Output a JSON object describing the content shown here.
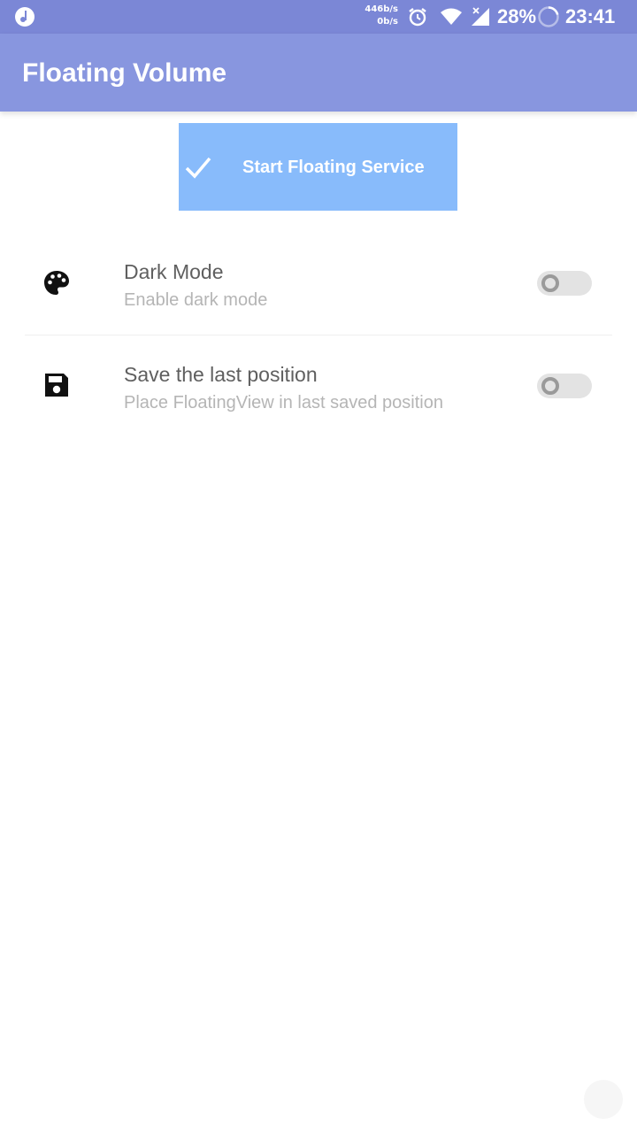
{
  "status_bar": {
    "net_up": "446b/s",
    "net_down": "0b/s",
    "battery": "28%",
    "time": "23:41",
    "icons": [
      "music-note-icon",
      "alarm-icon",
      "wifi-icon",
      "signal-icon",
      "battery-ring-icon"
    ]
  },
  "app_bar": {
    "title": "Floating Volume"
  },
  "start_button": {
    "label": "Start Floating Service",
    "icon": "check-icon"
  },
  "settings": [
    {
      "title": "Dark Mode",
      "subtitle": "Enable dark mode",
      "icon": "palette-icon",
      "enabled": false
    },
    {
      "title": "Save the last position",
      "subtitle": "Place FloatingView in last saved position",
      "icon": "floppy-disk-icon",
      "enabled": false
    }
  ],
  "colors": {
    "status_bar": "#7b87d6",
    "app_bar": "#8896df",
    "start_button": "#88bbfb",
    "toggle_off_track": "#e3e3e3",
    "toggle_off_thumb": "#9a9a9a"
  }
}
